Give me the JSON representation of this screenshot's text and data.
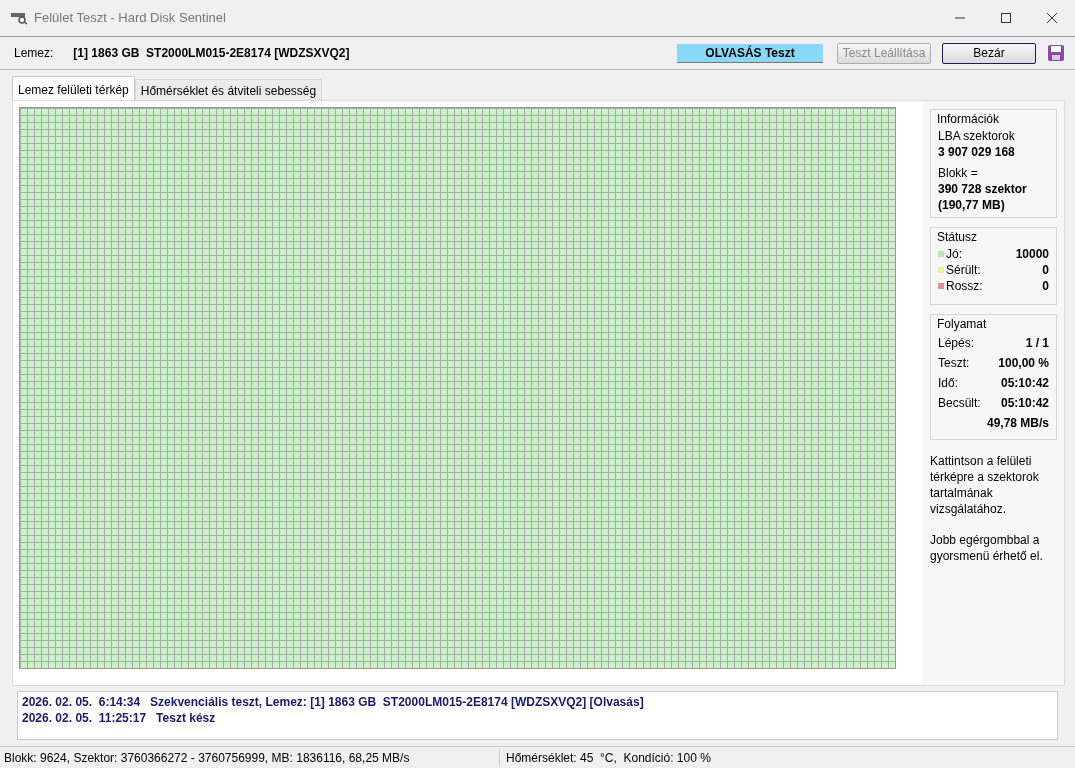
{
  "window": {
    "title": "Felület Teszt - Hard Disk Sentinel"
  },
  "disk": {
    "label": "Lemez:",
    "value": "[1] 1863 GB  ST2000LM015-2E8174 [WDZSXVQ2]"
  },
  "test_status": "OLVASÁS Teszt",
  "buttons": [
    {
      "label": "Teszt Leállítása",
      "disabled": true
    },
    {
      "label": "Bezár",
      "disabled": false
    }
  ],
  "tabs": [
    {
      "label": "Lemez felületi térkép",
      "selected": true
    },
    {
      "label": "Hőmérséklet és átviteli sebesség",
      "selected": false
    }
  ],
  "info": {
    "title": "Információk",
    "lines": [
      {
        "text": "LBA szektorok",
        "kind": "label"
      },
      {
        "text": "3 907 029 168",
        "kind": "value"
      },
      {
        "text": "Blokk =",
        "kind": "label"
      },
      {
        "text": "390 728 szektor",
        "kind": "value"
      },
      {
        "text": "(190,77 MB)",
        "kind": "value"
      }
    ]
  },
  "status": {
    "title": "Státusz",
    "rows": [
      {
        "label": "Jó:",
        "value": "10000",
        "color": "#b8e8b8"
      },
      {
        "label": "Sérült:",
        "value": "0",
        "color": "#f0f0a0"
      },
      {
        "label": "Rossz:",
        "value": "0",
        "color": "#e09090"
      }
    ]
  },
  "progress": {
    "title": "Folyamat",
    "rows": [
      {
        "label": "Lépés:",
        "value": "1 / 1"
      },
      {
        "label": "Teszt:",
        "value": "100,00 %"
      },
      {
        "label": "Idő:",
        "value": "05:10:42"
      },
      {
        "label": "Becsült:",
        "value": "05:10:42"
      },
      {
        "label": "",
        "value": "49,78 MB/s"
      }
    ]
  },
  "help": [
    "Kattintson a felületi térképre a szektorok tartalmának vizsgálatához.",
    "Jobb egérgombbal a gyorsmenü érhető el."
  ],
  "log": [
    "2026. 02. 05.  6:14:34   Szekvenciális teszt, Lemez: [1] 1863 GB  ST2000LM015-2E8174 [WDZSXVQ2] [Olvasás]",
    "2026. 02. 05.  11:25:17   Teszt kész"
  ],
  "status_bar": [
    "Blokk: 9624, Szektor: 3760366272 - 3760756999, MB: 1836116, 68,25 MB/s",
    "Hőmérséklet: 45  °C,  Kondíció: 100 %"
  ]
}
